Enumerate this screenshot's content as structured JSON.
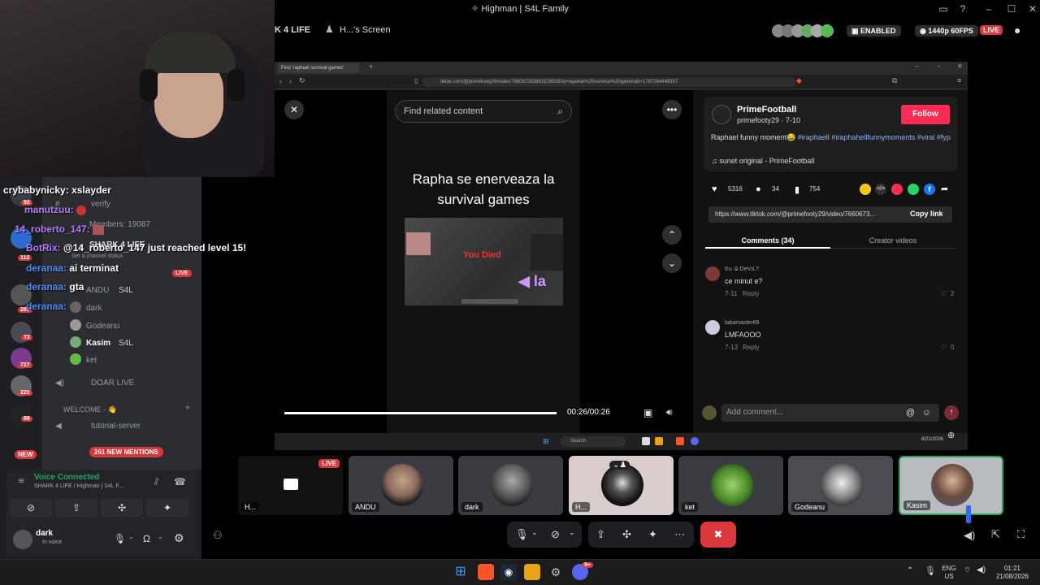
{
  "window": {
    "title": "Highman | S4L Family"
  },
  "stream_header": {
    "server_fragment": "K 4 LIFE",
    "screen_title": "H...'s Screen",
    "enabled_label": "ENABLED",
    "quality_label": "1440p 60FPS",
    "live_label": "LIVE"
  },
  "chat": {
    "lines": [
      {
        "user": "crybabynicky:",
        "text": "xslayder",
        "color": "#ffffff"
      },
      {
        "user": "manutzuu:",
        "text": "",
        "color": "#b77cff"
      },
      {
        "user": "14_roberto_147:",
        "text": "",
        "color": "#b77cff"
      },
      {
        "user": "BotRix:",
        "text": "@14_roberto_147 just reached level 15!",
        "color": "#b77cff"
      },
      {
        "user": "deranaa:",
        "text": "ai terminat",
        "color": "#4f8cff"
      },
      {
        "user": "deranaa:",
        "text": "gta",
        "color": "#4f8cff"
      },
      {
        "user": "deranaa:",
        "text": "",
        "color": "#4f8cff"
      }
    ]
  },
  "discord": {
    "server_badges": [
      "92",
      "112",
      "261",
      "73",
      "727",
      "220",
      "86",
      "NEW"
    ],
    "channels": {
      "verify": "verify",
      "members": "Members: 19087",
      "server_name": "SHARK 4 LIFE",
      "status_hint": "Set a channel status",
      "live_label": "LIVE",
      "users": [
        {
          "name": "ANDU",
          "tag": "S4L"
        },
        {
          "name": "dark",
          "tag": ""
        },
        {
          "name": "Godeanu",
          "tag": ""
        },
        {
          "name": "Kasim",
          "tag": "S4L"
        },
        {
          "name": "ket",
          "tag": ""
        }
      ],
      "doar_live": "DOAR LIVE",
      "welcome_category": "WELCOME - 👋",
      "tutorial": "tutorial-server"
    },
    "mentions": "261 NEW MENTIONS",
    "voice": {
      "status": "Voice Connected",
      "channel": "SHARK 4 LIFE / Highman | S4L F..."
    },
    "user": {
      "name": "dark",
      "status": "In voice"
    }
  },
  "browser": {
    "tab_title": "Find 'raphael survival games'",
    "url": "tiktok.com/@primefooty29/video/7660673539615295582q=rapahel%20survival%20games&t=1787264448357"
  },
  "tiktok": {
    "search_placeholder": "Find related content",
    "caption_line1": "Rapha se enerveaza la",
    "caption_line2": "survival games",
    "game_overlay": "You Died",
    "time": "00:26/00:26",
    "author_name": "PrimeFootball",
    "author_handle": "primefooty29 · 7-10",
    "follow_label": "Follow",
    "description": "Raphael funny moment😂",
    "hashtags": "#iraphaell #iraphahellfunnymoments #viral #fyp",
    "sound": "sunet original - PrimeFootball",
    "likes": "5316",
    "comments_count": "34",
    "saves": "754",
    "link": "https://www.tiktok.com/@primefooty29/video/7660673...",
    "copy_link": "Copy link",
    "tab_comments": "Comments (34)",
    "tab_creator": "Creator videos",
    "comments": [
      {
        "user": "𝔈𝔯𝔢 ♧ DeVıL?",
        "text": "ce minut e?",
        "date": "7-11",
        "reply": "Reply",
        "likes": "2"
      },
      {
        "user": "labamaster69",
        "text": "LMFAOOO",
        "date": "7-13",
        "reply": "Reply",
        "likes": "0"
      }
    ],
    "add_comment_placeholder": "Add comment..."
  },
  "inner_taskbar": {
    "search": "Search",
    "date": "8/21/2026"
  },
  "tiles": [
    {
      "label": "H...",
      "live": "LIVE"
    },
    {
      "label": "ANDU"
    },
    {
      "label": "dark"
    },
    {
      "label": "H..."
    },
    {
      "label": "ket"
    },
    {
      "label": "Godeanu"
    },
    {
      "label": "Kasim"
    }
  ],
  "os_tray": {
    "lang": "ENG",
    "region": "US",
    "time": "01:21",
    "date": "21/08/2026",
    "discord_badge": "9+"
  }
}
